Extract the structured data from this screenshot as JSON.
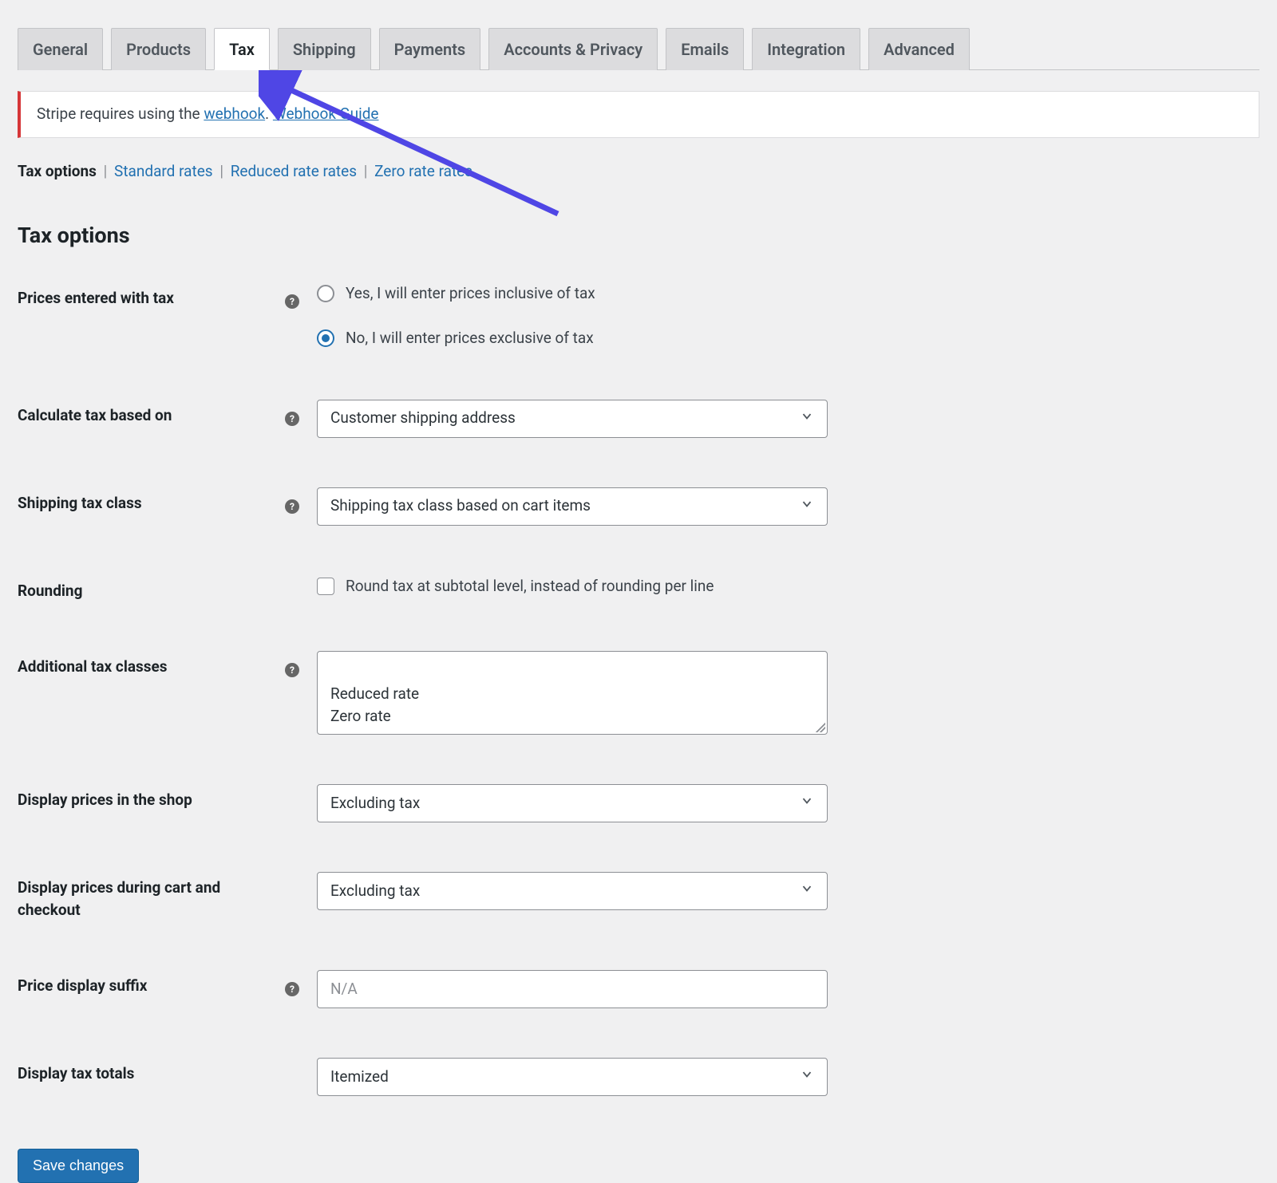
{
  "tabs": {
    "general": "General",
    "products": "Products",
    "tax": "Tax",
    "shipping": "Shipping",
    "payments": "Payments",
    "accounts_privacy": "Accounts & Privacy",
    "emails": "Emails",
    "integration": "Integration",
    "advanced": "Advanced",
    "active": "tax"
  },
  "notice": {
    "prefix": "Stripe requires using the ",
    "link1": "webhook",
    "mid": ". ",
    "link2": "Webhook Guide"
  },
  "subnav": {
    "tax_options": "Tax options",
    "standard_rates": "Standard rates",
    "reduced_rate_rates": "Reduced rate rates",
    "zero_rate_rates": "Zero rate rates"
  },
  "heading": "Tax options",
  "labels": {
    "prices_entered_with_tax": "Prices entered with tax",
    "calculate_tax_based_on": "Calculate tax based on",
    "shipping_tax_class": "Shipping tax class",
    "rounding": "Rounding",
    "additional_tax_classes": "Additional tax classes",
    "display_prices_in_shop": "Display prices in the shop",
    "display_prices_cart_checkout": "Display prices during cart and checkout",
    "price_display_suffix": "Price display suffix",
    "display_tax_totals": "Display tax totals"
  },
  "fields": {
    "prices_entered_with_tax": {
      "option_yes": "Yes, I will enter prices inclusive of tax",
      "option_no": "No, I will enter prices exclusive of tax",
      "selected": "no"
    },
    "calculate_tax_based_on": "Customer shipping address",
    "shipping_tax_class": "Shipping tax class based on cart items",
    "rounding_label": "Round tax at subtotal level, instead of rounding per line",
    "rounding_checked": false,
    "additional_tax_classes": "Reduced rate\nZero rate",
    "display_prices_in_shop": "Excluding tax",
    "display_prices_cart_checkout": "Excluding tax",
    "price_display_suffix_placeholder": "N/A",
    "display_tax_totals": "Itemized"
  },
  "buttons": {
    "save_changes": "Save changes"
  },
  "colors": {
    "accent": "#2271b1",
    "notice_border": "#d63638",
    "arrow": "#4f46e5"
  }
}
